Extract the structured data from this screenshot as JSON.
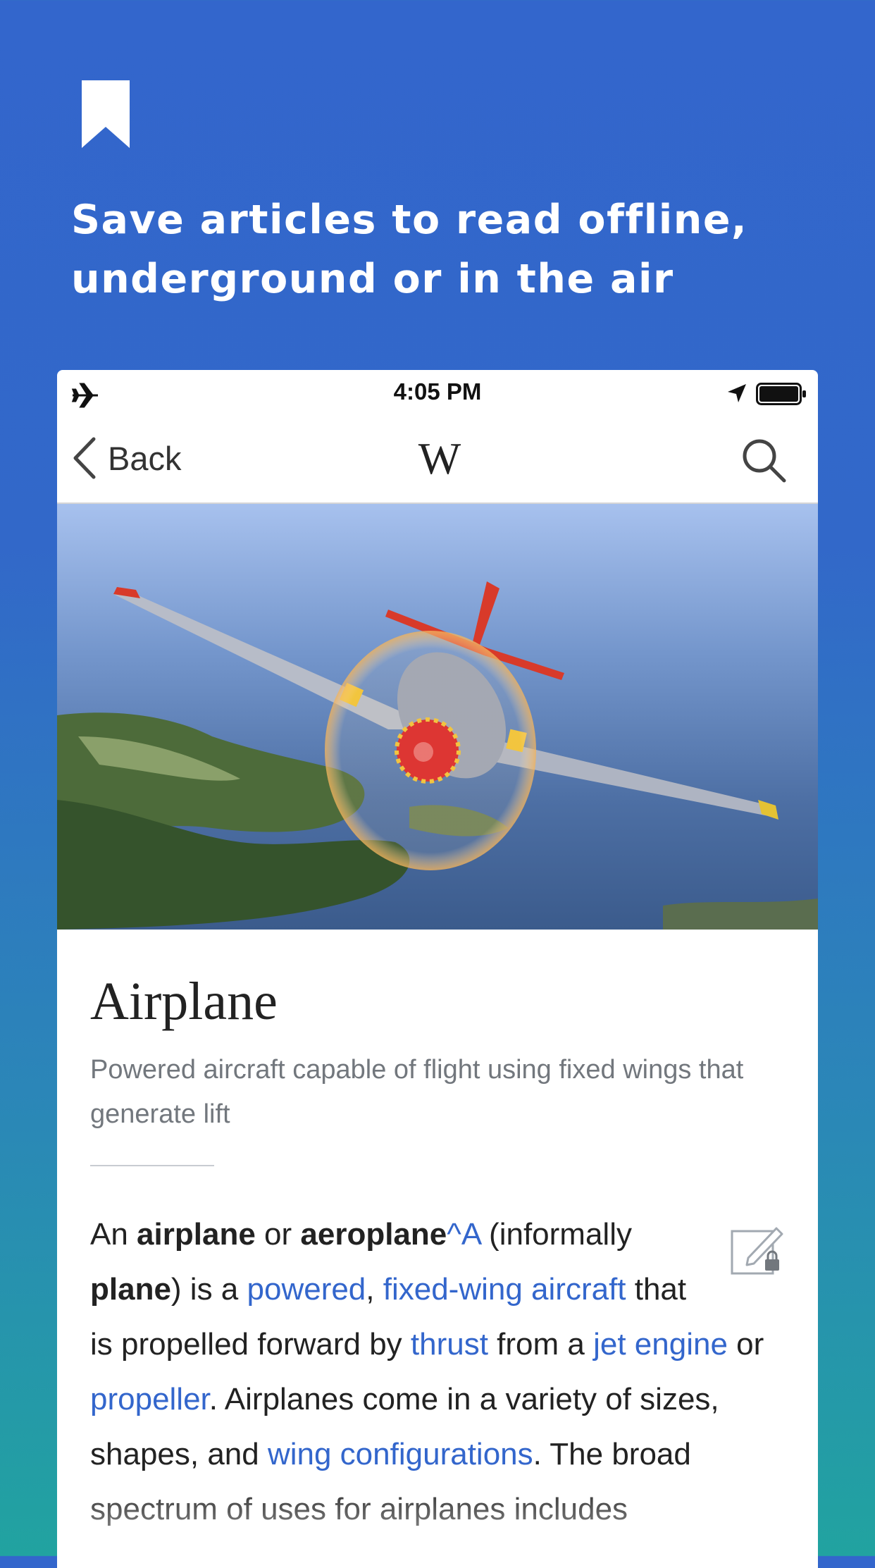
{
  "promo": {
    "headline_line1": "Save articles to read offline,",
    "headline_line2": "underground or in the air",
    "icon": "bookmark-icon"
  },
  "status_bar": {
    "time": "4:05 PM",
    "icons": [
      "airplane-mode-icon",
      "location-arrow-icon",
      "battery-icon"
    ]
  },
  "nav": {
    "back_label": "Back",
    "logo": "W",
    "icons": [
      "chevron-left-icon",
      "search-icon"
    ]
  },
  "article": {
    "title": "Airplane",
    "description": "Powered aircraft capable of flight using fixed wings that generate lift",
    "body": {
      "t1": "An ",
      "b1": "airplane",
      "t2": " or ",
      "b2": "aeroplane",
      "l0": "^A",
      "t3": " (informally ",
      "b3": "plane",
      "t4": ") is a ",
      "l1": "powered",
      "t5": ", ",
      "l2": "fixed-wing aircraft",
      "t6": " that is propelled forward by ",
      "l3": "thrust",
      "t7": " from a ",
      "l4": "jet engine",
      "t8": " or ",
      "l5": "propeller",
      "t9": ". Airplanes come in a variety of sizes, shapes, and ",
      "l6": "wing configurations",
      "t10": ". The broad spectrum of uses for airplanes includes"
    }
  },
  "colors": {
    "background_top": "#3366cc",
    "background_bottom": "#21a3a0",
    "link": "#3366cc",
    "text": "#222222",
    "description": "#72777d"
  }
}
